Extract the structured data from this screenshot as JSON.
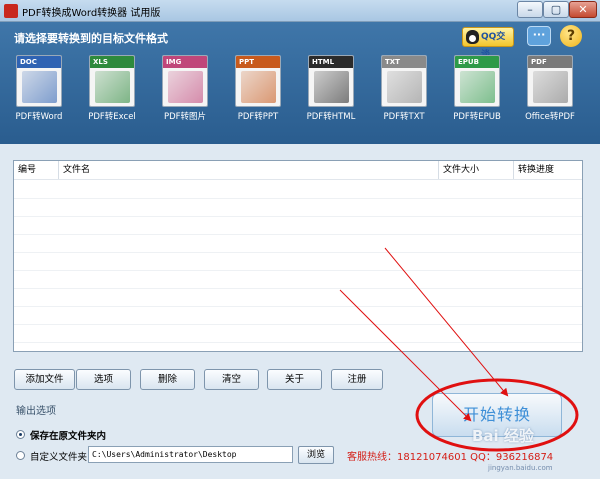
{
  "window": {
    "title": "PDF转换成Word转换器 试用版",
    "controls": {
      "minimize": "–",
      "maximize": "▢",
      "close": "✕"
    }
  },
  "topbar": {
    "heading": "请选择要转换到的目标文件格式",
    "qq_label": "QQ交谈",
    "chat_glyph": "···",
    "help_glyph": "?"
  },
  "formats": [
    {
      "tag": "DOC",
      "label": "PDF转Word",
      "color": "#2f63b3",
      "icon": "word-document-icon"
    },
    {
      "tag": "XLS",
      "label": "PDF转Excel",
      "color": "#2e8a3c",
      "icon": "excel-chart-icon"
    },
    {
      "tag": "IMG",
      "label": "PDF转图片",
      "color": "#c0467a",
      "icon": "image-landscape-icon"
    },
    {
      "tag": "PPT",
      "label": "PDF转PPT",
      "color": "#c85a1c",
      "icon": "ppt-check-icon"
    },
    {
      "tag": "HTML",
      "label": "PDF转HTML",
      "color": "#2b2b2b",
      "icon": "html-globe-icon"
    },
    {
      "tag": "TXT",
      "label": "PDF转TXT",
      "color": "#8a8a8a",
      "icon": "text-document-icon"
    },
    {
      "tag": "EPUB",
      "label": "PDF转EPUB",
      "color": "#2e9a48",
      "icon": "epub-book-icon"
    },
    {
      "tag": "PDF",
      "label": "Office转PDF",
      "color": "#7a7a7a",
      "icon": "pdf-acrobat-icon"
    }
  ],
  "table": {
    "columns": [
      "编号",
      "文件名",
      "文件大小",
      "转换进度"
    ]
  },
  "buttons": {
    "add_file": "添加文件",
    "options": "选项",
    "delete": "删除",
    "clear": "清空",
    "about": "关于",
    "register": "注册",
    "browse": "浏览",
    "start": "开始转换"
  },
  "output": {
    "section_label": "输出选项",
    "save_in_source": "保存在原文件夹内",
    "custom_folder": "自定义文件夹",
    "folder_path": "C:\\Users\\Administrator\\Desktop",
    "selected": "save_in_source"
  },
  "hotline": "客服热线：18121074601 QQ：936216874",
  "watermark": {
    "text": "Bai 经验",
    "url": "jingyan.baidu.com"
  },
  "colors": {
    "topbar": "#3a6ea0",
    "annotation": "#e01010",
    "hotline": "#d41e16"
  }
}
